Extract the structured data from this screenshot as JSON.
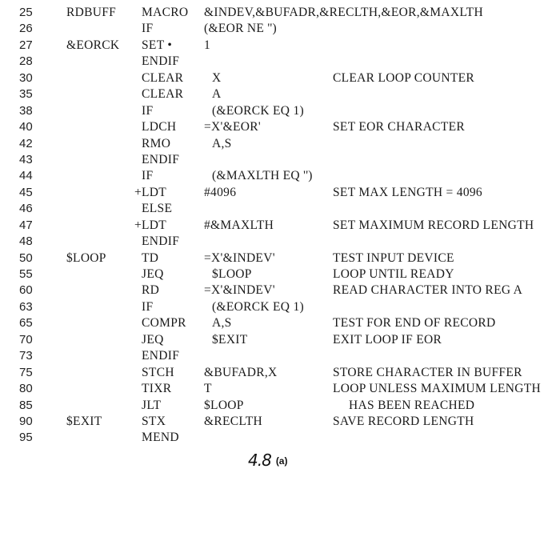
{
  "listing": {
    "rows": [
      {
        "line": "25",
        "label": "RDBUFF",
        "opcode": "MACRO",
        "operand": "&INDEV,&BUFADR,&RECLTH,&EOR,&MAXLTH",
        "comment": ""
      },
      {
        "line": "26",
        "label": "",
        "opcode": "IF",
        "operand": "(&EOR NE '')",
        "comment": ""
      },
      {
        "line": "27",
        "label": "&EORCK",
        "opcode": "SET •",
        "operand": "1",
        "comment": ""
      },
      {
        "line": "28",
        "label": "",
        "opcode": "ENDIF",
        "operand": "",
        "comment": ""
      },
      {
        "line": "30",
        "label": "",
        "opcode": "CLEAR",
        "operand": "X",
        "comment": "CLEAR LOOP COUNTER"
      },
      {
        "line": "35",
        "label": "",
        "opcode": "CLEAR",
        "operand": "A",
        "comment": ""
      },
      {
        "line": "38",
        "label": "",
        "opcode": "IF",
        "operand": "(&EORCK EQ 1)",
        "comment": ""
      },
      {
        "line": "40",
        "label": "",
        "opcode": "LDCH",
        "operand": "=X'&EOR'",
        "comment": "SET EOR CHARACTER"
      },
      {
        "line": "42",
        "label": "",
        "opcode": "RMO",
        "operand": "A,S",
        "comment": ""
      },
      {
        "line": "43",
        "label": "",
        "opcode": "ENDIF",
        "operand": "",
        "comment": ""
      },
      {
        "line": "44",
        "label": "",
        "opcode": "IF",
        "operand": "(&MAXLTH EQ '')",
        "comment": ""
      },
      {
        "line": "45",
        "label": "",
        "opcode": "+LDT",
        "operand": "#4096",
        "comment": "SET MAX LENGTH = 4096"
      },
      {
        "line": "46",
        "label": "",
        "opcode": "ELSE",
        "operand": "",
        "comment": ""
      },
      {
        "line": "47",
        "label": "",
        "opcode": "+LDT",
        "operand": "#&MAXLTH",
        "comment": "SET MAXIMUM RECORD LENGTH"
      },
      {
        "line": "48",
        "label": "",
        "opcode": "ENDIF",
        "operand": "",
        "comment": ""
      },
      {
        "line": "50",
        "label": "$LOOP",
        "opcode": "TD",
        "operand": "=X'&INDEV'",
        "comment": "TEST INPUT DEVICE"
      },
      {
        "line": "55",
        "label": "",
        "opcode": "JEQ",
        "operand": "$LOOP",
        "comment": "LOOP UNTIL READY"
      },
      {
        "line": "60",
        "label": "",
        "opcode": "RD",
        "operand": "=X'&INDEV'",
        "comment": "READ CHARACTER INTO REG A"
      },
      {
        "line": "63",
        "label": "",
        "opcode": "IF",
        "operand": "(&EORCK EQ 1)",
        "comment": ""
      },
      {
        "line": "65",
        "label": "",
        "opcode": "COMPR",
        "operand": "A,S",
        "comment": "TEST FOR END OF RECORD"
      },
      {
        "line": "70",
        "label": "",
        "opcode": "JEQ",
        "operand": "$EXIT",
        "comment": "EXIT LOOP IF EOR"
      },
      {
        "line": "73",
        "label": "",
        "opcode": "ENDIF",
        "operand": "",
        "comment": ""
      },
      {
        "line": "75",
        "label": "",
        "opcode": "STCH",
        "operand": "&BUFADR,X",
        "comment": "STORE CHARACTER IN BUFFER"
      },
      {
        "line": "80",
        "label": "",
        "opcode": "TIXR",
        "operand": "T",
        "comment": "LOOP UNLESS MAXIMUM LENGTH"
      },
      {
        "line": "85",
        "label": "",
        "opcode": "JLT",
        "operand": "$LOOP",
        "comment": "HAS BEEN REACHED"
      },
      {
        "line": "90",
        "label": "$EXIT",
        "opcode": "STX",
        "operand": "&RECLTH",
        "comment": "SAVE RECORD LENGTH"
      },
      {
        "line": "95",
        "label": "",
        "opcode": "MEND",
        "operand": "",
        "comment": ""
      }
    ]
  },
  "caption": {
    "figure": "4.8",
    "part": "(a)"
  }
}
